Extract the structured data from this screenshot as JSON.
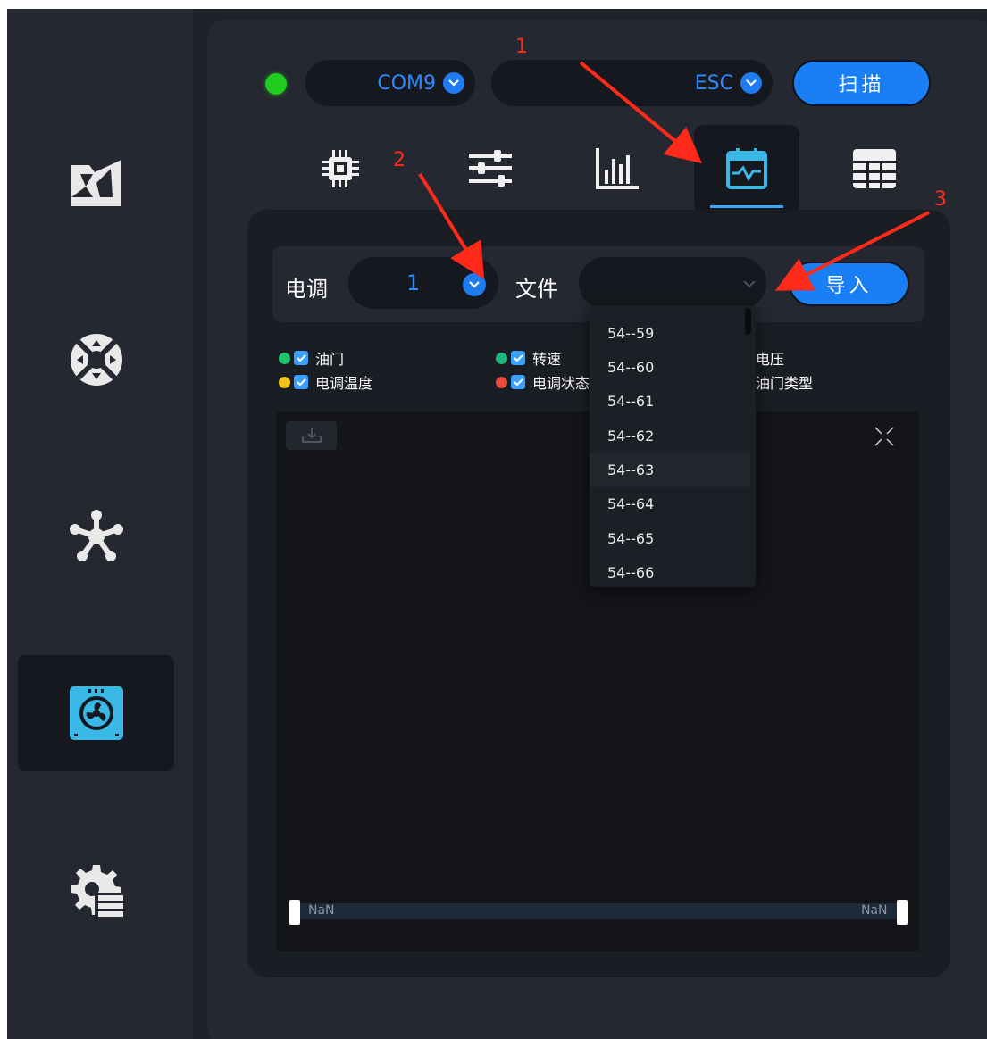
{
  "top_bar": {
    "port_value": "COM9",
    "device_value": "ESC",
    "scan_label": "扫描",
    "status_color": "#1fcc1f"
  },
  "sidebar": {
    "items": [
      {
        "icon": "image-gallery-icon"
      },
      {
        "icon": "gamepad-dpad-icon"
      },
      {
        "icon": "network-nodes-icon"
      },
      {
        "icon": "fan-module-icon",
        "active": true
      },
      {
        "icon": "settings-list-icon"
      }
    ]
  },
  "tabs": [
    {
      "icon": "chip-icon"
    },
    {
      "icon": "sliders-icon"
    },
    {
      "icon": "bar-chart-icon"
    },
    {
      "icon": "waveform-log-icon",
      "active": true
    },
    {
      "icon": "table-icon"
    }
  ],
  "selector": {
    "esc_label": "电调",
    "esc_value": "1",
    "file_label": "文件",
    "import_label": "导入"
  },
  "legend": [
    {
      "label": "油门",
      "color": "#21c46a"
    },
    {
      "label": "转速",
      "color": "#21b57e"
    },
    {
      "label": "电压",
      "color": ""
    },
    {
      "label": "电调温度",
      "color": "#f0c419"
    },
    {
      "label": "电调状态",
      "color": "#e74c3c"
    },
    {
      "label": "油门类型",
      "color": ""
    }
  ],
  "dropdown": {
    "options": [
      "54--59",
      "54--60",
      "54--61",
      "54--62",
      "54--63",
      "54--64",
      "54--65",
      "54--66"
    ]
  },
  "slider": {
    "left_label": "NaN",
    "right_label": "NaN"
  },
  "annotations": [
    "1",
    "2",
    "3"
  ],
  "colors": {
    "accent": "#1a7ff5",
    "annotation": "#ff2a1a",
    "highlight": "#3aa6ff"
  }
}
